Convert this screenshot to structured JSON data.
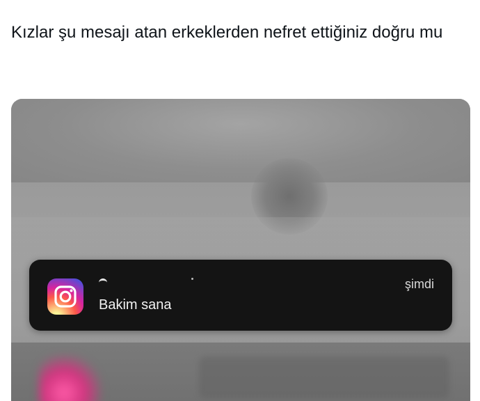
{
  "post": {
    "text": "Kızlar şu mesajı atan erkeklerden nefret ettiğiniz doğru mu"
  },
  "notification": {
    "app_icon": "instagram-icon",
    "time": "şimdi",
    "message": "Bakim sana"
  },
  "colors": {
    "notification_bg": "#141414",
    "text_primary": "#0f1419",
    "page_bg": "#ffffff"
  }
}
